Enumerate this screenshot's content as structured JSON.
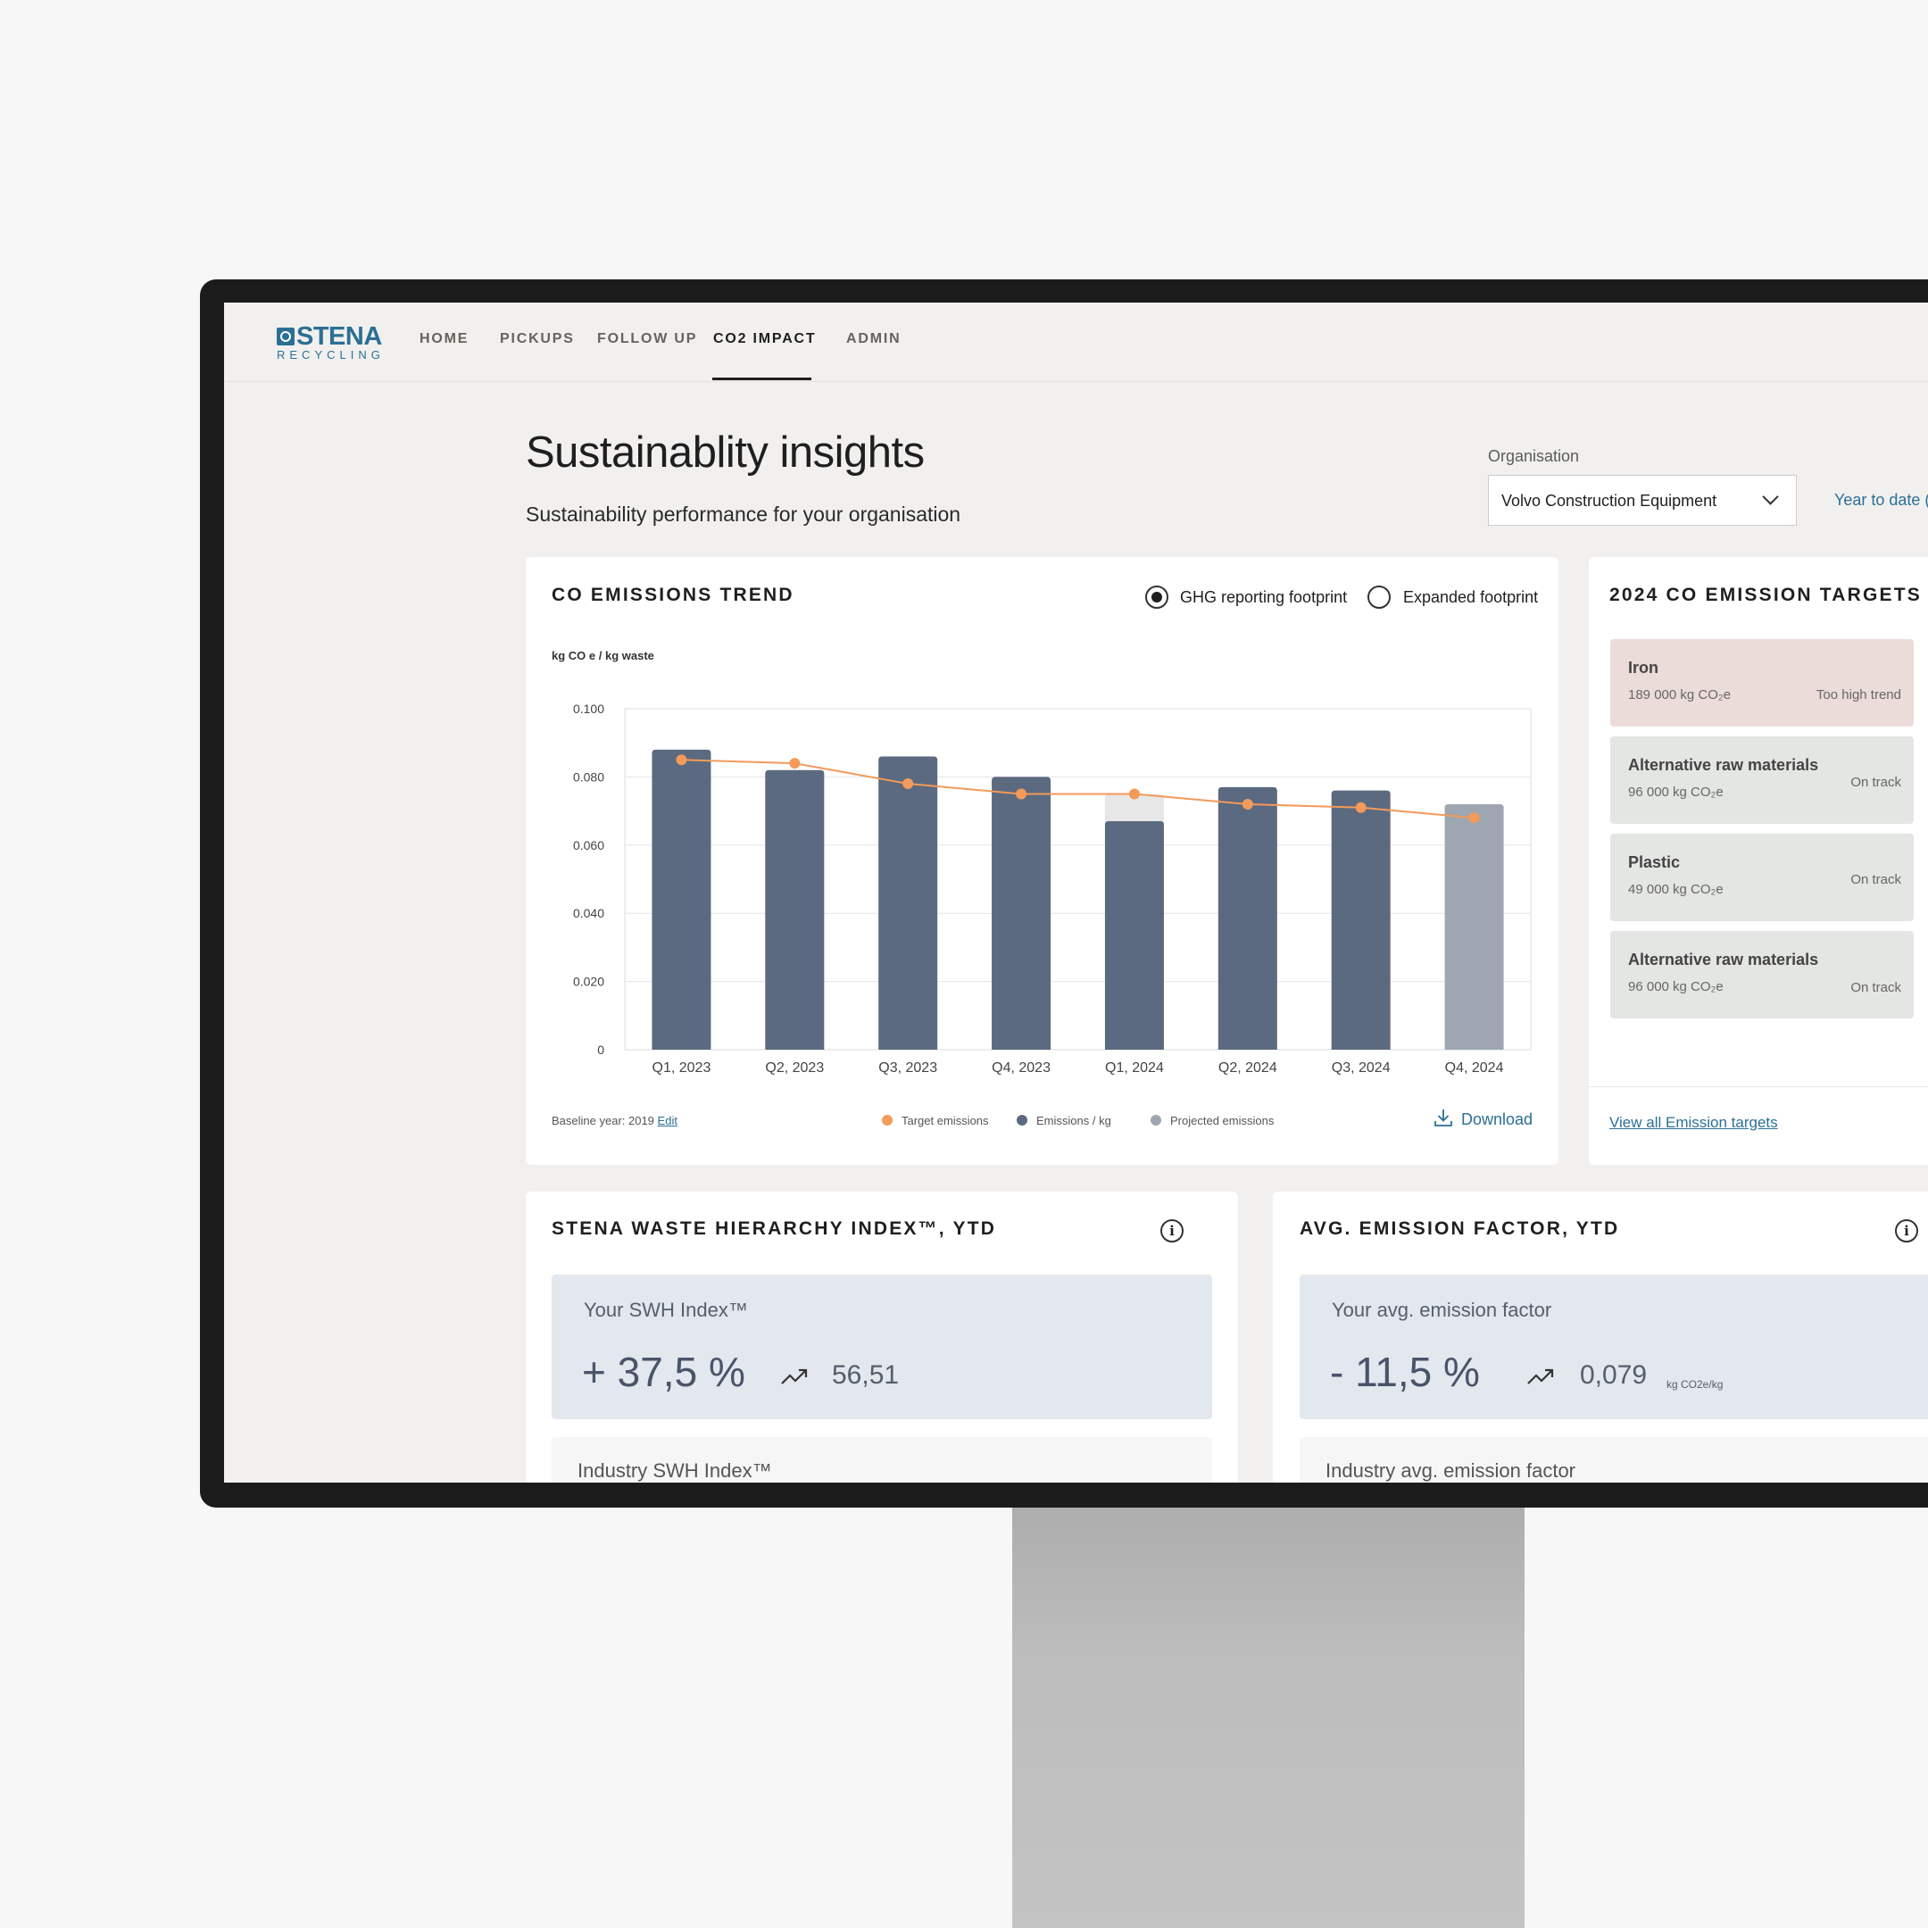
{
  "nav": {
    "logo_word": "STENA",
    "logo_sub": "RECYCLING",
    "items": [
      "HOME",
      "PICKUPS",
      "FOLLOW UP",
      "CO2 IMPACT",
      "ADMIN"
    ],
    "active": "CO2 IMPACT"
  },
  "header": {
    "title": "Sustainablity insights",
    "subtitle": "Sustainability performance for your organisation",
    "org_label": "Organisation",
    "org_value": "Volvo Construction Equipment",
    "period_link": "Year to date ("
  },
  "trend_card": {
    "title": "CO  EMISSIONS TREND",
    "options": [
      "GHG reporting footprint",
      "Expanded footprint"
    ],
    "selected_option": "GHG reporting footprint",
    "y_axis_label": "kg CO e  / kg waste",
    "baseline_text": "Baseline year: 2019",
    "baseline_edit": "Edit",
    "legend": [
      "Target emissions",
      "Emissions / kg",
      "Projected emissions"
    ],
    "download": "Download"
  },
  "chart_data": {
    "type": "bar",
    "categories": [
      "Q1, 2023",
      "Q2, 2023",
      "Q3, 2023",
      "Q4, 2023",
      "Q1, 2024",
      "Q2, 2024",
      "Q3, 2024",
      "Q4, 2024"
    ],
    "series": [
      {
        "name": "Emissions / kg",
        "values": [
          0.088,
          0.082,
          0.086,
          0.08,
          0.067,
          0.077,
          0.076,
          null
        ]
      },
      {
        "name": "Projected emissions",
        "values": [
          null,
          null,
          null,
          null,
          0.075,
          null,
          null,
          0.072
        ]
      },
      {
        "name": "Target emissions",
        "values": [
          0.085,
          0.084,
          0.078,
          0.075,
          0.075,
          0.072,
          0.071,
          0.068
        ]
      }
    ],
    "y_ticks": [
      "0",
      "0.020",
      "0.040",
      "0.060",
      "0.080",
      "0.100"
    ],
    "ylim": [
      0,
      0.1
    ],
    "grid": true,
    "colors": {
      "emissions": "#5b6a80",
      "projected": "#9da6b1",
      "projected_overlay": "#e7e7e7",
      "target": "#f49a5a"
    }
  },
  "targets_card": {
    "title": "2024 CO  EMISSION TARGETS",
    "items": [
      {
        "name": "Iron",
        "value": "189 000 kg CO₂e",
        "status": "Too high trend",
        "state": "bad"
      },
      {
        "name": "Alternative raw materials",
        "value": "96 000 kg CO₂e",
        "status": "On track",
        "state": "ok"
      },
      {
        "name": "Plastic",
        "value": "49 000 kg CO₂e",
        "status": "On track",
        "state": "ok"
      },
      {
        "name": "Alternative raw materials",
        "value": "96 000 kg CO₂e",
        "status": "On track",
        "state": "ok"
      }
    ],
    "view_all": "View all Emission targets"
  },
  "swh_card": {
    "title": "STENA WASTE HIERARCHY INDEX™, YTD",
    "label": "Your SWH Index™",
    "change": "+ 37,5 %",
    "value": "56,51",
    "industry_label": "Industry SWH Index™"
  },
  "emission_card": {
    "title": "AVG. EMISSION FACTOR, YTD",
    "label": "Your avg. emission factor",
    "change": "- 11,5 %",
    "value": "0,079",
    "unit": "kg CO2e/kg",
    "industry_label": "Industry avg. emission factor"
  }
}
